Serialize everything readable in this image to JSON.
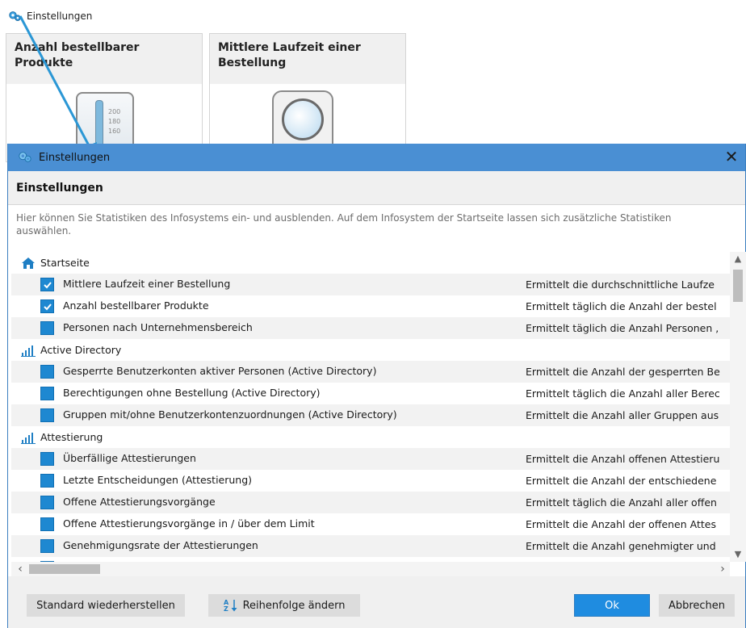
{
  "background": {
    "header_title": "Einstellungen",
    "tiles": [
      {
        "title": "Anzahl bestellbarer Produkte",
        "scale": [
          "200",
          "180",
          "160"
        ]
      },
      {
        "title": "Mittlere Laufzeit einer Bestellung"
      }
    ]
  },
  "dialog": {
    "window_title": "Einstellungen",
    "close_glyph": "✕",
    "header": "Einstellungen",
    "description": "Hier können Sie Statistiken des Infosystems ein- und ausblenden. Auf dem Infosystem der Startseite lassen sich zusätzliche Statistiken auswählen.",
    "groups": [
      {
        "name": "Startseite",
        "icon": "home-icon",
        "items": [
          {
            "label": "Mittlere Laufzeit einer Bestellung",
            "description": "Ermittelt die durchschnittliche Laufze",
            "checked": true
          },
          {
            "label": "Anzahl bestellbarer Produkte",
            "description": "Ermittelt täglich die Anzahl der bestel",
            "checked": true
          },
          {
            "label": "Personen nach Unternehmensbereich",
            "description": "Ermittelt täglich die Anzahl Personen ,",
            "checked": false
          }
        ]
      },
      {
        "name": "Active Directory",
        "icon": "bar-chart-icon",
        "items": [
          {
            "label": "Gesperrte Benutzerkonten aktiver Personen (Active Directory)",
            "description": "Ermittelt die Anzahl der gesperrten Be",
            "checked": false
          },
          {
            "label": "Berechtigungen ohne Bestellung (Active Directory)",
            "description": "Ermittelt täglich die Anzahl aller Berec",
            "checked": false
          },
          {
            "label": "Gruppen mit/ohne Benutzerkontenzuordnungen (Active Directory)",
            "description": "Ermittelt die Anzahl aller Gruppen aus",
            "checked": false
          }
        ]
      },
      {
        "name": "Attestierung",
        "icon": "bar-chart-icon",
        "items": [
          {
            "label": "Überfällige Attestierungen",
            "description": "Ermittelt die Anzahl offenen Attestieru",
            "checked": false
          },
          {
            "label": "Letzte Entscheidungen (Attestierung)",
            "description": "Ermittelt die Anzahl der entschiedene",
            "checked": false
          },
          {
            "label": "Offene Attestierungsvorgänge",
            "description": "Ermittelt täglich die Anzahl aller offen",
            "checked": false
          },
          {
            "label": "Offene Attestierungsvorgänge  in / über dem Limit",
            "description": "Ermittelt die Anzahl der offenen Attes",
            "checked": false
          },
          {
            "label": "Genehmigungsrate der Attestierungen",
            "description": "Ermittelt die Anzahl genehmigter und",
            "checked": false
          }
        ]
      }
    ],
    "buttons": {
      "restore": "Standard wiederherstellen",
      "reorder": "Reihenfolge ändern",
      "ok": "Ok",
      "cancel": "Abbrechen"
    },
    "accent_color": "#1f8ce0",
    "titlebar_color": "#4a8fd3"
  }
}
